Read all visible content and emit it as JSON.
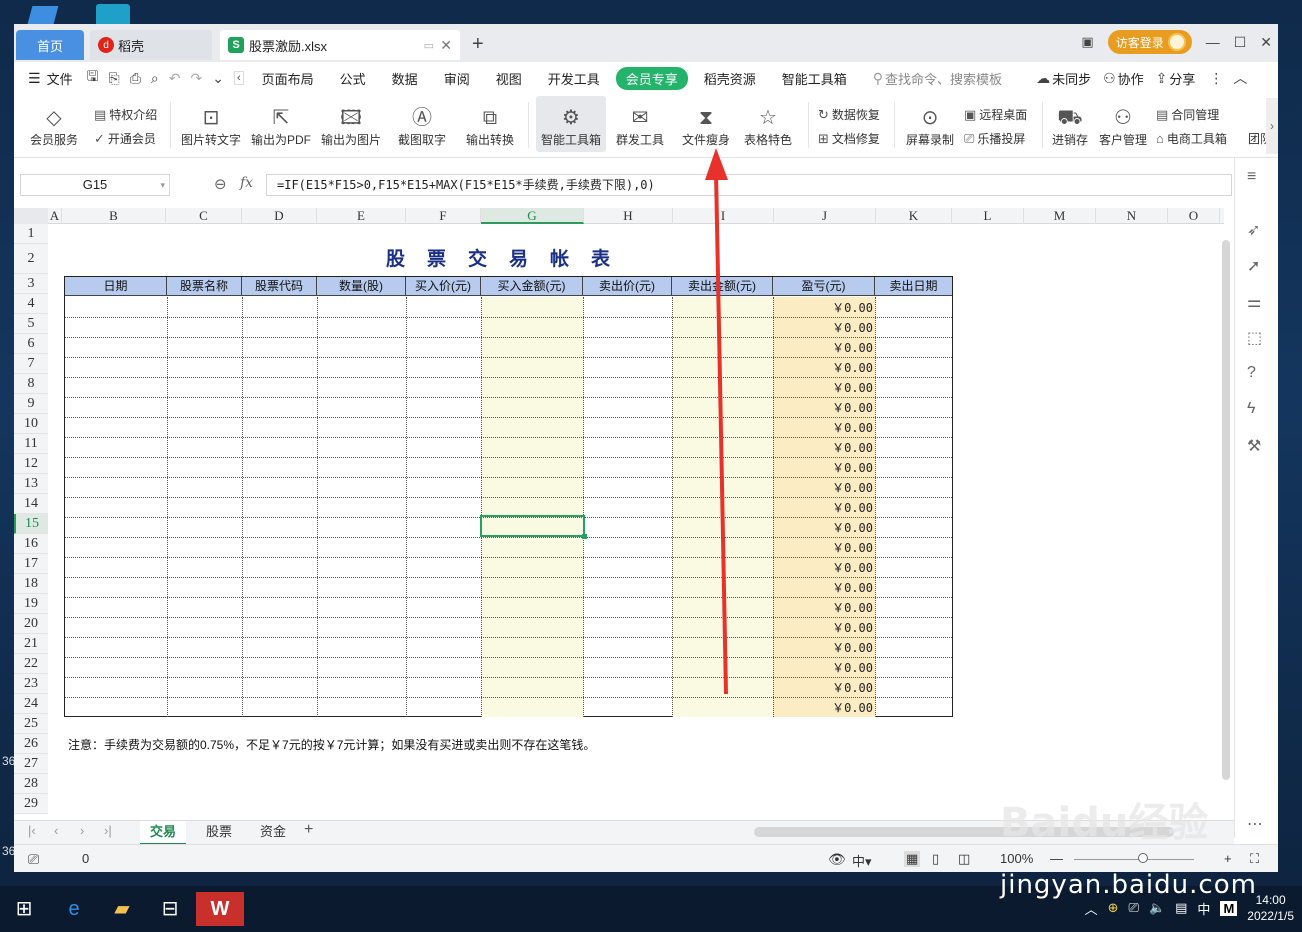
{
  "desktop": {
    "left_labels": [
      "36",
      "36"
    ]
  },
  "tabs": {
    "home": "首页",
    "daoke": "稻壳",
    "file": "股票激励.xlsx"
  },
  "titlebar": {
    "visitor": "访客登录"
  },
  "menu": {
    "file": "文件",
    "items": [
      "页面布局",
      "公式",
      "数据",
      "审阅",
      "视图",
      "开发工具"
    ],
    "vip": "会员专享",
    "items2": [
      "稻壳资源",
      "智能工具箱"
    ],
    "search": "查找命令、搜索模板",
    "sync": "未同步",
    "collab": "协作",
    "share": "分享"
  },
  "ribbon": {
    "member_service": "会员服务",
    "privilege": "特权介绍",
    "open_member": "开通会员",
    "img_to_text": "图片转文字",
    "to_pdf": "输出为PDF",
    "to_image": "输出为图片",
    "screenshot": "截图取字",
    "convert": "输出转换",
    "smart_tools": "智能工具箱",
    "group_tools": "群发工具",
    "slim": "文件瘦身",
    "table_feature": "表格特色",
    "data_recover": "数据恢复",
    "doc_repair": "文档修复",
    "screen_record": "屏幕录制",
    "remote_desktop": "远程桌面",
    "cast": "乐播投屏",
    "inventory": "进销存",
    "crm": "客户管理",
    "contract": "合同管理",
    "ecommerce": "电商工具箱",
    "team": "团队"
  },
  "formula": {
    "cell": "G15",
    "fx": "fx",
    "text": "=IF(E15*F15>0,F15*E15+MAX(F15*E15*手续费,手续费下限),0)"
  },
  "columns": [
    "A",
    "B",
    "C",
    "D",
    "E",
    "F",
    "G",
    "H",
    "I",
    "J",
    "K",
    "L",
    "M",
    "N",
    "O"
  ],
  "rows": [
    "1",
    "2",
    "3",
    "4",
    "5",
    "6",
    "7",
    "8",
    "9",
    "10",
    "11",
    "12",
    "13",
    "14",
    "15",
    "16",
    "17",
    "18",
    "19",
    "20",
    "21",
    "22",
    "23",
    "24",
    "25",
    "26",
    "27",
    "28",
    "29"
  ],
  "sheet": {
    "title": "股票交易帐表",
    "headers": [
      "日期",
      "股票名称",
      "股票代码",
      "数量(股)",
      "买入价(元)",
      "买入金额(元)",
      "卖出价(元)",
      "卖出金额(元)",
      "盈亏(元)",
      "卖出日期"
    ],
    "pnl_values": [
      "￥0.00",
      "￥0.00",
      "￥0.00",
      "￥0.00",
      "￥0.00",
      "￥0.00",
      "￥0.00",
      "￥0.00",
      "￥0.00",
      "￥0.00",
      "￥0.00",
      "￥0.00",
      "￥0.00",
      "￥0.00",
      "￥0.00",
      "￥0.00",
      "￥0.00",
      "￥0.00",
      "￥0.00",
      "￥0.00",
      "￥0.00"
    ],
    "note": "注意：手续费为交易额的0.75%，不足￥7元的按￥7元计算；如果没有买进或卖出则不存在这笔钱。"
  },
  "sheet_tabs": [
    "交易",
    "股票",
    "资金"
  ],
  "status": {
    "value": "0",
    "zoom": "100%"
  },
  "taskbar": {
    "time": "14:00",
    "date": "2022/1/5",
    "ime": "中",
    "ime2": "M"
  },
  "watermark": {
    "brand": "Baidu经验",
    "url": "jingyan.baidu.com"
  },
  "colors": {
    "accent": "#21a366",
    "header_fill": "#b7cbee",
    "arrow": "#e8312a",
    "vip": "#23b36b"
  }
}
